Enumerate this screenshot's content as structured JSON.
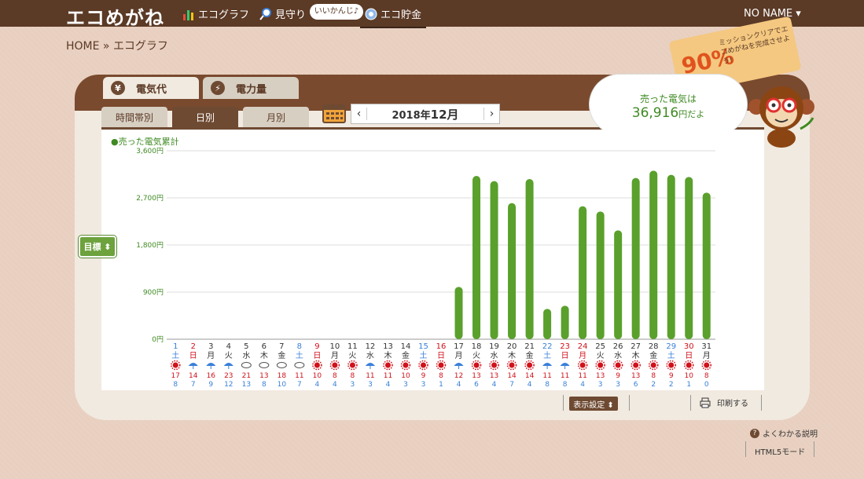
{
  "header": {
    "logo": "エコめがね",
    "nav_ecograph": "エコグラフ",
    "nav_mimamori": "見守り",
    "nav_bubble": "いいかんじ♪",
    "nav_chokin": "エコ貯金",
    "user": "NO NAME ▾"
  },
  "breadcrumb": "HOME » エコグラフ",
  "mission": {
    "percent": "90%",
    "text": "ミッションクリアでエコめがねを完成させよう!"
  },
  "tabs": {
    "cost": "電気代",
    "power": "電力量",
    "coin_symbol": "¥",
    "bolt_symbol": "⚡"
  },
  "subtabs": {
    "hourly": "時間帯別",
    "daily": "日別",
    "monthly": "月別"
  },
  "month_nav": {
    "prev": "‹",
    "year": "2018年",
    "month": "12月",
    "next": "›"
  },
  "sold": {
    "label": "売った電気は",
    "value": "36,916",
    "unit": "円だよ"
  },
  "legend": "●売った電気累計",
  "goal_button": "目標 ⬍",
  "display_settings": "表示設定 ⬍",
  "print": "印刷する",
  "help": "よくわかる説明",
  "html5": "HTML5モード",
  "colors": {
    "bar": "#5aa02c",
    "header": "#5b3a26",
    "sat": "#3a80d9",
    "sun": "#d0121b"
  },
  "chart_data": {
    "type": "bar",
    "y_unit": "円",
    "ylim": [
      0,
      3600
    ],
    "y_ticks": [
      0,
      900,
      1800,
      2700,
      3600
    ],
    "y_tick_labels": [
      "0円",
      "900円",
      "1,800円",
      "2,700円",
      "3,600円"
    ],
    "categories": [
      "1",
      "2",
      "3",
      "4",
      "5",
      "6",
      "7",
      "8",
      "9",
      "10",
      "11",
      "12",
      "13",
      "14",
      "15",
      "16",
      "17",
      "18",
      "19",
      "20",
      "21",
      "22",
      "23",
      "24",
      "25",
      "26",
      "27",
      "28",
      "29",
      "30",
      "31"
    ],
    "weekdays": [
      "土",
      "日",
      "月",
      "火",
      "水",
      "木",
      "金",
      "土",
      "日",
      "月",
      "火",
      "水",
      "木",
      "金",
      "土",
      "日",
      "月",
      "火",
      "水",
      "木",
      "金",
      "土",
      "日",
      "月",
      "火",
      "水",
      "木",
      "金",
      "土",
      "日",
      "月"
    ],
    "weather": [
      "sun",
      "rain",
      "rain",
      "rain",
      "cloud",
      "cloud",
      "cloud",
      "cloud",
      "sun",
      "sun",
      "sun",
      "rain",
      "sun",
      "sun",
      "sun",
      "sun",
      "rain",
      "sun",
      "sun",
      "sun",
      "sun",
      "rain",
      "rain",
      "sun",
      "sun",
      "sun",
      "sun",
      "sun",
      "sun",
      "sun",
      "sun"
    ],
    "temp_high": [
      "17",
      "14",
      "16",
      "23",
      "21",
      "13",
      "18",
      "11",
      "10",
      "8",
      "8",
      "11",
      "11",
      "10",
      "9",
      "8",
      "12",
      "13",
      "13",
      "14",
      "14",
      "11",
      "11",
      "11",
      "13",
      "9",
      "13",
      "8",
      "9",
      "10",
      "8"
    ],
    "temp_low": [
      "8",
      "7",
      "9",
      "12",
      "13",
      "8",
      "10",
      "7",
      "4",
      "4",
      "3",
      "3",
      "4",
      "3",
      "3",
      "1",
      "4",
      "6",
      "4",
      "7",
      "4",
      "8",
      "8",
      "4",
      "3",
      "3",
      "6",
      "2",
      "2",
      "1",
      "0"
    ],
    "values": [
      0,
      0,
      0,
      0,
      0,
      0,
      0,
      0,
      0,
      0,
      0,
      0,
      0,
      0,
      0,
      0,
      1000,
      3120,
      3020,
      2600,
      3060,
      580,
      640,
      2540,
      2440,
      2080,
      3080,
      3220,
      3140,
      3100,
      2800
    ]
  }
}
